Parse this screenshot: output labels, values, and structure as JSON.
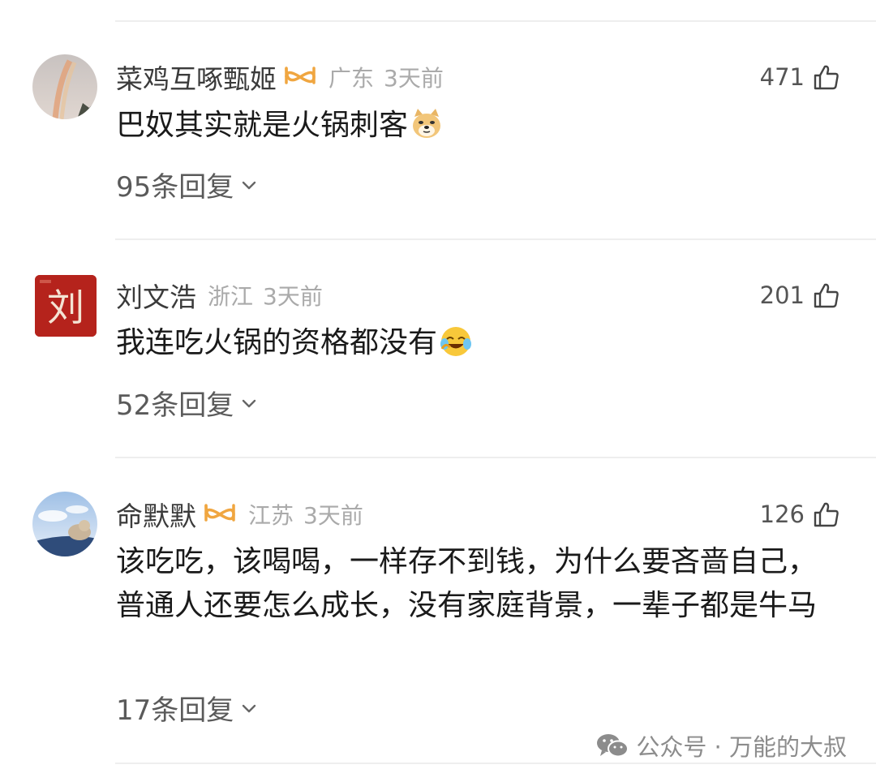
{
  "comments": [
    {
      "user": "菜鸡互啄甄姬",
      "vip": true,
      "location": "广东",
      "time": "3天前",
      "likes": "471",
      "text": "巴奴其实就是火锅刺客",
      "emoji": "doge-emoji",
      "replies": "95条回复"
    },
    {
      "user": "刘文浩",
      "vip": false,
      "location": "浙江",
      "time": "3天前",
      "likes": "201",
      "text": "我连吃火锅的资格都没有",
      "emoji": "crying-laughing-emoji",
      "avatar_text": "刘",
      "replies": "52条回复"
    },
    {
      "user": "命默默",
      "vip": true,
      "location": "江苏",
      "time": "3天前",
      "likes": "126",
      "text": "该吃吃，该喝喝，一样存不到钱，为什么要吝啬自己，普通人还要怎么成长，没有家庭背景，一辈子都是牛马",
      "replies": "17条回复"
    }
  ],
  "watermark": {
    "text": "公众号 · 万能的大叔"
  },
  "colors": {
    "vip": "#f0a640",
    "avatar_red": "#b5231c",
    "divider": "#eeeeee"
  }
}
